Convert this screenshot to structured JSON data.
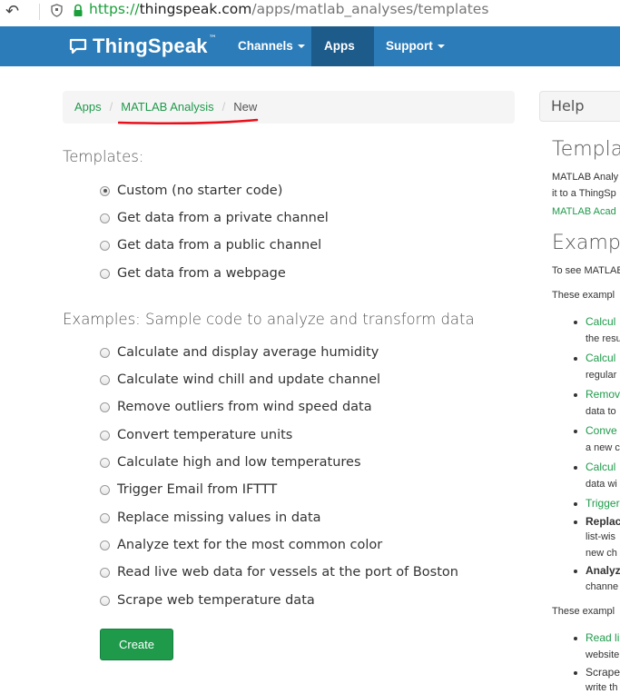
{
  "browser": {
    "url_scheme": "https://",
    "url_host": "thingspeak.com",
    "url_path": "/apps/matlab_analyses/templates"
  },
  "nav": {
    "brand": "ThingSpeak",
    "brand_tm": "™",
    "items": [
      {
        "label": "Channels",
        "active": false
      },
      {
        "label": "Apps",
        "active": true
      },
      {
        "label": "Support",
        "active": false
      }
    ]
  },
  "breadcrumb": {
    "items": [
      "Apps",
      "MATLAB Analysis"
    ],
    "divider": "/",
    "current": "New"
  },
  "templates": {
    "title": "Templates:",
    "options": [
      {
        "label": "Custom (no starter code)",
        "checked": true
      },
      {
        "label": "Get data from a private channel",
        "checked": false
      },
      {
        "label": "Get data from a public channel",
        "checked": false
      },
      {
        "label": "Get data from a webpage",
        "checked": false
      }
    ]
  },
  "examples": {
    "title": "Examples: Sample code to analyze and transform data",
    "options": [
      "Calculate and display average humidity",
      "Calculate wind chill and update channel",
      "Remove outliers from wind speed data",
      "Convert temperature units",
      "Calculate high and low temperatures",
      "Trigger Email from IFTTT",
      "Replace missing values in data",
      "Analyze text for the most common color",
      "Read live web data for vessels at the port of Boston",
      "Scrape web temperature data"
    ]
  },
  "create_button": "Create",
  "help": {
    "header": "Help",
    "heading1": "Templa",
    "para1_line1": "MATLAB Analy",
    "para1_line2": "it to a ThingSp",
    "para1_link": "MATLAB Acad",
    "heading2": "Examp",
    "para2": "To see MATLAB",
    "para3": "These exampl",
    "list": [
      {
        "title": "Calcul",
        "sub": "the resu",
        "style": "green"
      },
      {
        "title": "Calcul",
        "sub": "regular",
        "style": "green"
      },
      {
        "title": "Remov",
        "sub": "data to",
        "style": "green"
      },
      {
        "title": "Conve",
        "sub": "a new c",
        "style": "green"
      },
      {
        "title": "Calcul",
        "sub": "data wi",
        "style": "green"
      },
      {
        "title": "Trigger",
        "sub": "",
        "style": "green"
      },
      {
        "title": "Replace",
        "sub": "list-wis",
        "sub2": "new ch",
        "style": "dark"
      },
      {
        "title": "Analyze",
        "sub": "channe",
        "style": "dark"
      }
    ],
    "para4": "These exampl",
    "list2": [
      {
        "title": "Read li",
        "sub": "website",
        "style": "green"
      },
      {
        "title": "Scrape",
        "sub": "write th",
        "style": "dark"
      }
    ]
  },
  "colors": {
    "navbar": "#2b7cb9",
    "navbar_active": "#1d5b8a",
    "link_green": "#1f9a4b",
    "annotation_red": "#e8101a"
  }
}
